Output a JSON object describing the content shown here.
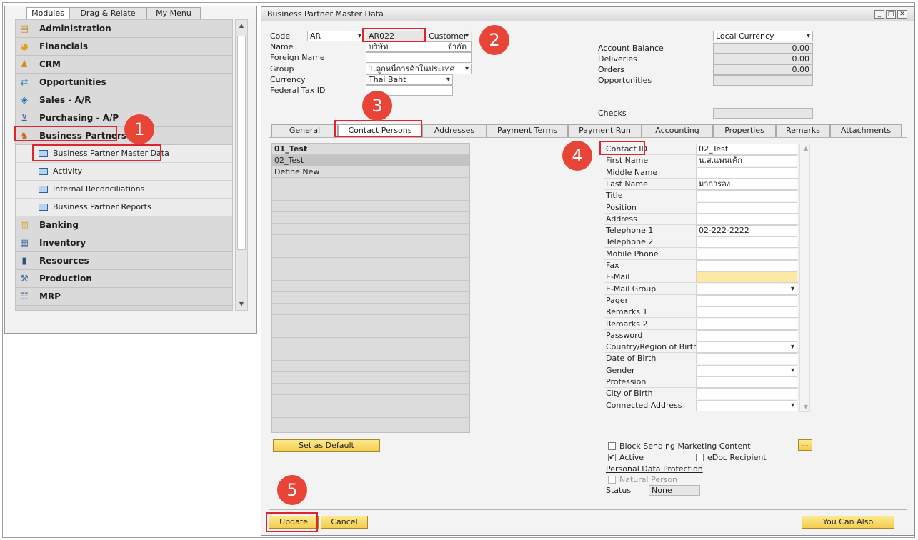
{
  "modules_panel": {
    "tabs": [
      "Modules",
      "Drag & Relate",
      "My Menu"
    ],
    "items": [
      {
        "label": "Administration",
        "icon": "admin-icon"
      },
      {
        "label": "Financials",
        "icon": "financials-icon"
      },
      {
        "label": "CRM",
        "icon": "crm-icon"
      },
      {
        "label": "Opportunities",
        "icon": "opportunities-icon"
      },
      {
        "label": "Sales - A/R",
        "icon": "sales-icon"
      },
      {
        "label": "Purchasing - A/P",
        "icon": "cart-icon"
      },
      {
        "label": "Business Partners",
        "icon": "partners-icon"
      }
    ],
    "sub_items": [
      {
        "label": "Business Partner Master Data"
      },
      {
        "label": "Activity"
      },
      {
        "label": "Internal Reconciliations"
      },
      {
        "label": "Business Partner Reports"
      }
    ],
    "items_after": [
      {
        "label": "Banking",
        "icon": "banking-icon"
      },
      {
        "label": "Inventory",
        "icon": "inventory-icon"
      },
      {
        "label": "Resources",
        "icon": "resources-icon"
      },
      {
        "label": "Production",
        "icon": "production-icon"
      },
      {
        "label": "MRP",
        "icon": "mrp-icon"
      }
    ]
  },
  "window": {
    "title": "Business Partner Master Data",
    "header": {
      "code_label": "Code",
      "code_series": "AR",
      "code_value": "AR022",
      "type_value": "Customer",
      "name_label": "Name",
      "name_value_left": "บริษัท",
      "name_value_right": "จำกัด",
      "foreign_name_label": "Foreign Name",
      "foreign_name_value": "",
      "group_label": "Group",
      "group_value": "1.ลูกหนี้การค้าในประเทศ",
      "currency_label": "Currency",
      "currency_value": "Thai Baht",
      "federal_tax_label": "Federal Tax ID",
      "federal_tax_value": "",
      "currency_mode": "Local Currency",
      "account_balance_label": "Account Balance",
      "account_balance_value": "0.00",
      "deliveries_label": "Deliveries",
      "deliveries_value": "0.00",
      "orders_label": "Orders",
      "orders_value": "0.00",
      "opportunities_label": "Opportunities",
      "opportunities_value": "",
      "checks_label": "Checks",
      "checks_value": ""
    },
    "tabs": [
      "General",
      "Contact Persons",
      "Addresses",
      "Payment Terms",
      "Payment Run",
      "Accounting",
      "Properties",
      "Remarks",
      "Attachments"
    ],
    "contacts": [
      "01_Test",
      "02_Test",
      "Define New"
    ],
    "fields": [
      {
        "label": "Contact ID",
        "value": "02_Test"
      },
      {
        "label": "First Name",
        "value": "น.ส.แพนเค้ก"
      },
      {
        "label": "Middle Name",
        "value": ""
      },
      {
        "label": "Last Name",
        "value": "มาการอง"
      },
      {
        "label": "Title",
        "value": ""
      },
      {
        "label": "Position",
        "value": ""
      },
      {
        "label": "Address",
        "value": ""
      },
      {
        "label": "Telephone 1",
        "value": "02-222-2222"
      },
      {
        "label": "Telephone 2",
        "value": ""
      },
      {
        "label": "Mobile Phone",
        "value": ""
      },
      {
        "label": "Fax",
        "value": ""
      },
      {
        "label": "E-Mail",
        "value": ""
      },
      {
        "label": "E-Mail Group",
        "value": ""
      },
      {
        "label": "Pager",
        "value": ""
      },
      {
        "label": "Remarks 1",
        "value": ""
      },
      {
        "label": "Remarks 2",
        "value": ""
      },
      {
        "label": "Password",
        "value": ""
      },
      {
        "label": "Country/Region of Birth",
        "value": ""
      },
      {
        "label": "Date of Birth",
        "value": ""
      },
      {
        "label": "Gender",
        "value": ""
      },
      {
        "label": "Profession",
        "value": ""
      },
      {
        "label": "City of Birth",
        "value": ""
      },
      {
        "label": "Connected Address",
        "value": ""
      }
    ],
    "set_default_label": "Set as Default",
    "block_marketing_label": "Block Sending Marketing Content",
    "more_button_label": "...",
    "active_label": "Active",
    "active_checked": true,
    "edoc_label": "eDoc Recipient",
    "pdp_label": "Personal Data Protection",
    "natural_person_label": "Natural Person",
    "status_label": "Status",
    "status_value": "None",
    "update_label": "Update",
    "cancel_label": "Cancel",
    "you_can_also_label": "You Can Also"
  },
  "annotations": [
    "1",
    "2",
    "3",
    "4",
    "5"
  ],
  "colors": {
    "highlight_red": "#e0242b",
    "badge_red": "#e94438",
    "button_yellow": "#f3cd4f",
    "field_yellow": "#fbe9a5"
  }
}
